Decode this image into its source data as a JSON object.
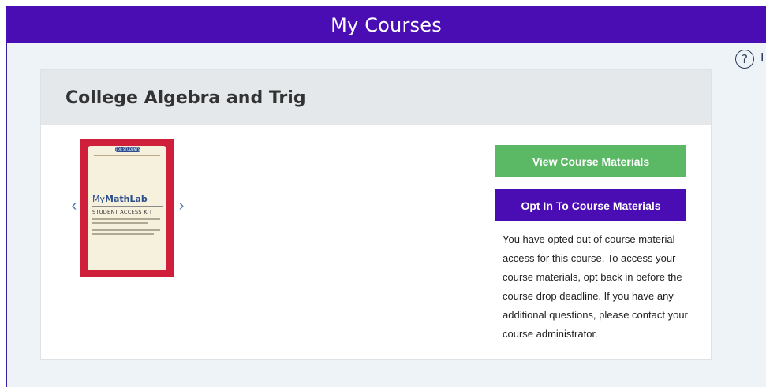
{
  "header": {
    "title": "My Courses"
  },
  "help": {
    "icon": "help-circle-icon",
    "glyph": "?"
  },
  "clipped_letter": "I",
  "course": {
    "title": "College Algebra and Trig",
    "book": {
      "pill": "FOR STUDENTS",
      "logo_prefix": "My",
      "logo_main": "MathLab",
      "kit_label": "STUDENT ACCESS KIT"
    },
    "carousel": {
      "prev_glyph": "‹",
      "next_glyph": "›"
    },
    "buttons": {
      "view": "View Course Materials",
      "optin": "Opt In To Course Materials"
    },
    "notice": "You have opted out of course material access for this course. To access your course materials, opt back in before the course drop deadline. If you have any additional questions, please contact your course administrator."
  },
  "colors": {
    "header_bg": "#4a0db3",
    "view_button": "#5bb865",
    "optin_button": "#4a0db3",
    "book_red": "#cf1f3a"
  }
}
